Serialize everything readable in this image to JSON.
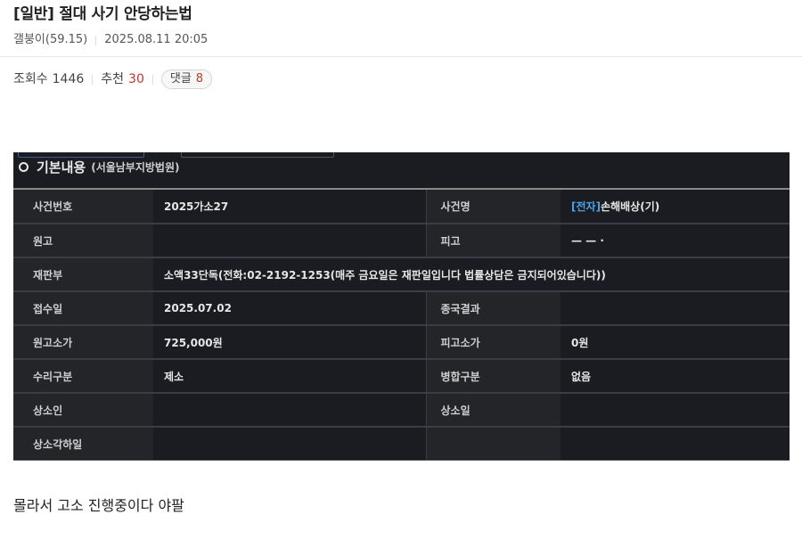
{
  "post": {
    "title": "[일반] 절대 사기 안당하는법",
    "author": "갤붕이(59.15)",
    "datetime": "2025.08.11 20:05",
    "views_label": "조회수",
    "views": "1446",
    "recommend_label": "추천",
    "recommend": "30",
    "comments_label": "댓글",
    "comments": "8",
    "body": "몰라서 고소 진행중이다 야팔"
  },
  "embed": {
    "section_title": "기본내용",
    "section_sub": "(서울남부지방법원)",
    "rows": [
      {
        "l1": "사건번호",
        "v1": "2025가소27",
        "l2": "사건명",
        "v2_tag": "[전자]",
        "v2": "손해배상(기)"
      },
      {
        "l1": "원고",
        "v1": "",
        "l2": "피고",
        "v2_tag": "",
        "v2": "— — ·"
      },
      {
        "l1": "재판부",
        "v1": "소액33단독(전화:02-2192-1253(매주 금요일은 재판일입니다 법률상담은 금지되어있습니다))",
        "l2": "",
        "v2_tag": "",
        "v2": ""
      },
      {
        "l1": "접수일",
        "v1": "2025.07.02",
        "l2": "종국결과",
        "v2_tag": "",
        "v2": ""
      },
      {
        "l1": "원고소가",
        "v1": "725,000원",
        "l2": "피고소가",
        "v2_tag": "",
        "v2": "0원"
      },
      {
        "l1": "수리구분",
        "v1": "제소",
        "l2": "병합구분",
        "v2_tag": "",
        "v2": "없음"
      },
      {
        "l1": "상소인",
        "v1": "",
        "l2": "상소일",
        "v2_tag": "",
        "v2": ""
      },
      {
        "l1": "상소각하일",
        "v1": "",
        "l2": "",
        "v2_tag": "",
        "v2": ""
      }
    ]
  }
}
